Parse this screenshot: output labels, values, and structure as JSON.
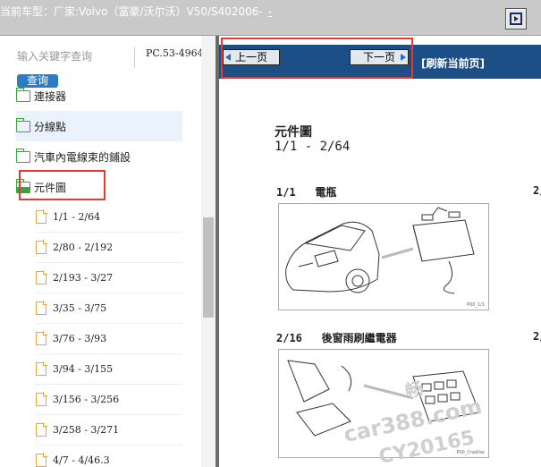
{
  "header": {
    "label": "当前车型：",
    "vehicle": "厂家:Volvo（富豪/沃尔沃）V50/S402006-",
    "link_text": "-"
  },
  "sidebar": {
    "search_label": "输入关键字查询",
    "search_button": "查询",
    "doc_code": "PC.53-4964",
    "folders": [
      {
        "label": "連接器"
      },
      {
        "label": "分線點"
      },
      {
        "label": "汽車內電線束的鋪設"
      },
      {
        "label": "元件圖"
      }
    ],
    "files": [
      {
        "label": "1/1 - 2/64"
      },
      {
        "label": "2/80 - 2/192"
      },
      {
        "label": "2/193 - 3/27"
      },
      {
        "label": "3/35 - 3/75"
      },
      {
        "label": "3/76 - 3/93"
      },
      {
        "label": "3/94 - 3/155"
      },
      {
        "label": "3/156 - 3/256"
      },
      {
        "label": "3/258 - 3/271"
      },
      {
        "label": "4/7 - 4/46.3"
      }
    ]
  },
  "toolbar": {
    "prev_label": "上一页",
    "next_label": "下一页",
    "refresh_label": "[刷新当前页]"
  },
  "document": {
    "title": "元件圖",
    "range": "1/1 - 2/64",
    "components": [
      {
        "code": "1/1",
        "name": "電瓶",
        "image_tag": "P00_1/1"
      },
      {
        "code": "2/16",
        "name": "後窗雨刷繼電器",
        "image_tag": "P00_Cradilar"
      }
    ],
    "partial_codes": [
      "2/",
      "2/"
    ]
  },
  "watermark": {
    "line1": "畅",
    "line2": "car388.com",
    "line3": "CY20165"
  },
  "colors": {
    "nav_bar": "#1c4f86",
    "search_button": "#2b7cc7",
    "folder_icon": "#3aa33a",
    "file_icon": "#f0a23a",
    "highlight_box": "#e53935"
  }
}
